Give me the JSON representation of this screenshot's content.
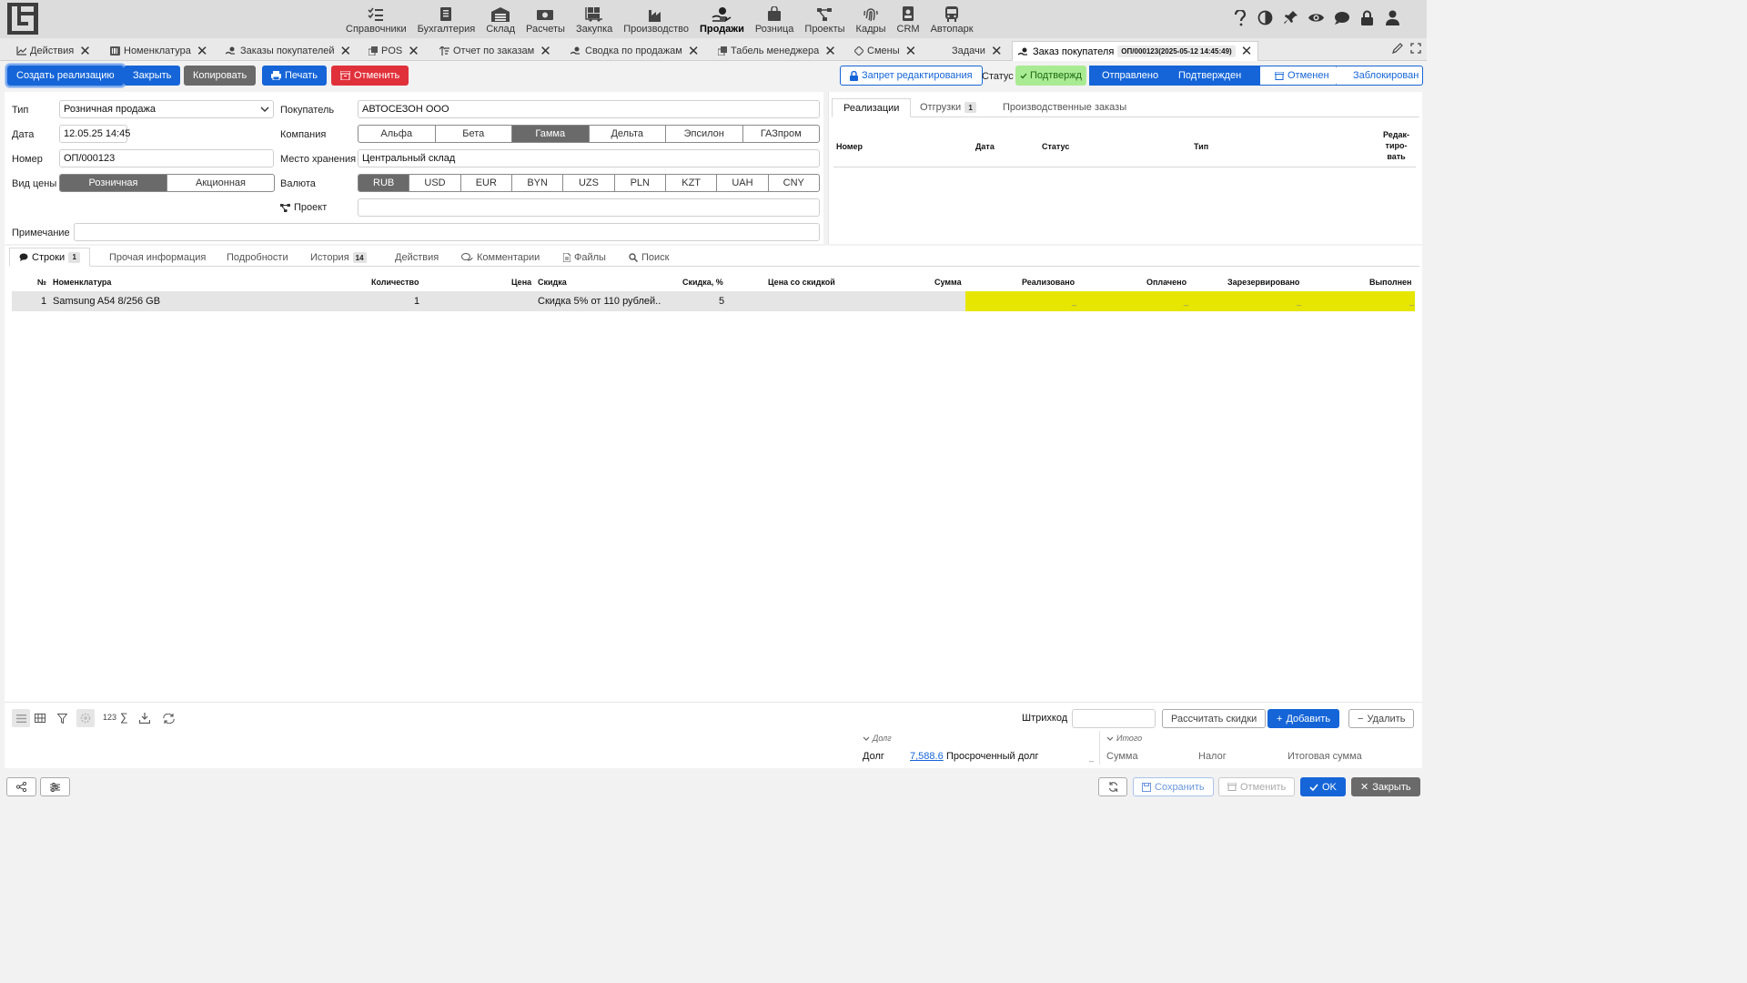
{
  "modules": [
    {
      "label": "Справочники",
      "icon": "list-check-icon"
    },
    {
      "label": "Бухгалтерия",
      "icon": "ledger-book-icon"
    },
    {
      "label": "Склад",
      "icon": "warehouse-icon"
    },
    {
      "label": "Расчеты",
      "icon": "money-bills-icon"
    },
    {
      "label": "Закупка",
      "icon": "dolly-boxes-icon"
    },
    {
      "label": "Производство",
      "icon": "factory-icon"
    },
    {
      "label": "Продажи",
      "icon": "hand-money-icon",
      "active": true
    },
    {
      "label": "Розница",
      "icon": "shopping-bag-icon"
    },
    {
      "label": "Проекты",
      "icon": "project-diagram-icon"
    },
    {
      "label": "Кадры",
      "icon": "fingerprint-icon"
    },
    {
      "label": "CRM",
      "icon": "contact-card-icon"
    },
    {
      "label": "Автопарк",
      "icon": "bus-icon"
    }
  ],
  "top_right_icons": [
    "help-icon",
    "contrast-icon",
    "pin-icon",
    "eye-icon",
    "chat-icon",
    "lock-icon",
    "user-icon"
  ],
  "tabs": [
    {
      "label": "Действия",
      "icon": "chart-line-icon"
    },
    {
      "label": "Номенклатура",
      "icon": "barcode-icon"
    },
    {
      "label": "Заказы покупателей",
      "icon": "hand-money-icon"
    },
    {
      "label": "POS",
      "icon": "copy-icon"
    },
    {
      "label": "Отчет по заказам",
      "icon": "sort-icon"
    },
    {
      "label": "Сводка по продажам",
      "icon": "hand-money-icon"
    },
    {
      "label": "Табель менеджера",
      "icon": "copy-icon"
    },
    {
      "label": "Смены",
      "icon": "diamond-icon"
    },
    {
      "label": "Задачи",
      "icon": "none"
    },
    {
      "label": "Заказ покупателя",
      "icon": "hand-money-icon",
      "badge": "ОП/000123(2025-05-12 14:45:49)",
      "active": true
    }
  ],
  "toolbar": {
    "create_realization": "Создать реализацию",
    "close": "Закрыть",
    "copy": "Копировать",
    "print": "Печать",
    "cancel": "Отменить",
    "edit_lock": "Запрет редактирования",
    "status_label": "Статус",
    "status_value": "Подтвержд",
    "pipeline": [
      "Отправлено",
      "Подтвержден",
      "Отменен",
      "Заблокирован"
    ]
  },
  "colors": {
    "primary": "#1565d8",
    "danger": "#e0313b",
    "status_green": "#a9eb93",
    "highlight_yellow": "#e6e600"
  },
  "form": {
    "type_label": "Тип",
    "type_value": "Розничная продажа",
    "date_label": "Дата",
    "date_value": "12.05.25 14:45",
    "number_label": "Номер",
    "number_value": "ОП/000123",
    "price_kind_label": "Вид цены",
    "price_kinds": [
      "Розничная",
      "Акционная"
    ],
    "buyer_label": "Покупатель",
    "buyer_value": "АВТОСЕЗОН ООО",
    "company_label": "Компания",
    "companies": [
      "Альфа",
      "Бета",
      "Гамма",
      "Дельта",
      "Эпсилон",
      "ГАЗпром"
    ],
    "company_selected": "Гамма",
    "storage_label": "Место хранения",
    "storage_value": "Центральный склад",
    "currency_label": "Валюта",
    "currencies": [
      "RUB",
      "USD",
      "EUR",
      "BYN",
      "UZS",
      "PLN",
      "KZT",
      "UAH",
      "CNY"
    ],
    "currency_selected": "RUB",
    "project_label": "Проект",
    "project_value": "",
    "note_label": "Примечание",
    "note_value": ""
  },
  "right_panel": {
    "tabs": [
      {
        "label": "Реализации",
        "active": true
      },
      {
        "label": "Отгрузки",
        "badge": "1"
      },
      {
        "label": "Производственные заказы"
      }
    ],
    "columns": [
      "Номер",
      "Дата",
      "Статус",
      "Тип",
      "Редак-\nтиро-\nвать"
    ]
  },
  "lower_tabs": [
    {
      "label": "Строки",
      "icon": "comment-icon",
      "badge": "1",
      "active": true
    },
    {
      "label": "Прочая информация"
    },
    {
      "label": "Подробности"
    },
    {
      "label": "История",
      "badge": "14"
    },
    {
      "label": "Действия"
    },
    {
      "label": "Комментарии",
      "icon": "comments-icon"
    },
    {
      "label": "Файлы",
      "icon": "file-icon"
    },
    {
      "label": "Поиск",
      "icon": "search-icon"
    }
  ],
  "lines_table": {
    "columns": [
      "№",
      "Номенклатура",
      "Количество",
      "Цена",
      "Скидка",
      "Скидка, %",
      "Цена со скидкой",
      "Сумма",
      "Реализовано",
      "Оплачено",
      "Зарезервировано",
      "Выполнен"
    ],
    "rows": [
      {
        "n": "1",
        "item": "Samsung A54 8/256 GB",
        "qty": "1",
        "price": "",
        "discount": "Скидка 5% от 110 рублей...",
        "discount_pct": "5",
        "discounted_price": "",
        "sum": "",
        "realized": "_",
        "paid": "_",
        "reserved": "_",
        "done": "_"
      }
    ]
  },
  "bottom_bar": {
    "numbers_label": "123",
    "sum_symbol": "∑",
    "barcode_label": "Штрихкод",
    "barcode_value": "",
    "calc_discounts": "Рассчитать скидки",
    "add": "Добавить",
    "remove": "Удалить"
  },
  "debt": {
    "section": "Долг",
    "label": "Долг",
    "value": "7,588.6",
    "overdue_label": "Просроченный долг",
    "overdue_value": "_"
  },
  "totals": {
    "section": "Итого",
    "sum_label": "Сумма",
    "tax_label": "Налог",
    "total_label": "Итоговая сумма"
  },
  "footer": {
    "save": "Сохранить",
    "cancel": "Отменить",
    "ok": "OK",
    "close": "Закрыть"
  }
}
